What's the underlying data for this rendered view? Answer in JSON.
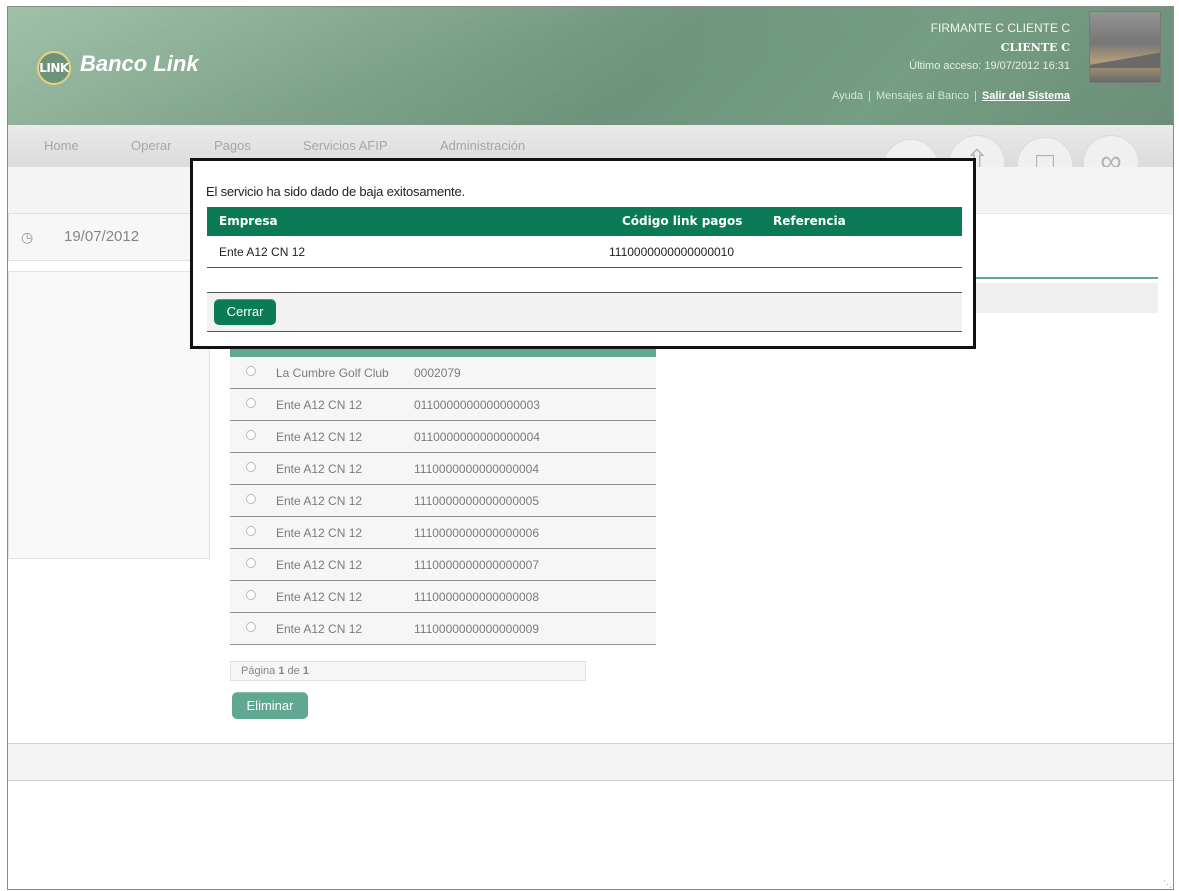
{
  "header": {
    "brand": "Banco Link",
    "logo_text": "LINK",
    "user_name": "FIRMANTE C CLIENTE C",
    "client_name": "CLIENTE C",
    "last_access": "Último acceso: 19/07/2012 16:31",
    "links": {
      "help": "Ayuda",
      "sep1": "|",
      "messages": "Mensajes al Banco",
      "sep2": "|",
      "logout": "Salir del Sistema"
    }
  },
  "nav": {
    "items": [
      "Home",
      "Operar",
      "Pagos",
      "Servicios AFIP",
      "Administración"
    ],
    "icons": [
      "user-icon",
      "upload-icon",
      "folder-icon",
      "attachments-icon"
    ]
  },
  "page": {
    "date": "19/07/2012",
    "services": [
      {
        "name": "La Cumbre Golf Club",
        "code": "0002079"
      },
      {
        "name": "Ente A12 CN 12",
        "code": "0110000000000000003"
      },
      {
        "name": "Ente A12 CN 12",
        "code": "0110000000000000004"
      },
      {
        "name": "Ente A12 CN 12",
        "code": "1110000000000000004"
      },
      {
        "name": "Ente A12 CN 12",
        "code": "1110000000000000005"
      },
      {
        "name": "Ente A12 CN 12",
        "code": "1110000000000000006"
      },
      {
        "name": "Ente A12 CN 12",
        "code": "1110000000000000007"
      },
      {
        "name": "Ente A12 CN 12",
        "code": "1110000000000000008"
      },
      {
        "name": "Ente A12 CN 12",
        "code": "1110000000000000009"
      }
    ],
    "pager": {
      "prefix": "Página",
      "current": "1",
      "of": "de",
      "total": "1"
    },
    "delete_label": "Eliminar"
  },
  "modal": {
    "message": "El servicio ha sido dado de baja exitosamente.",
    "columns": {
      "company": "Empresa",
      "code": "Código link pagos",
      "reference": "Referencia"
    },
    "row": {
      "company": "Ente A12 CN 12",
      "code": "1110000000000000010",
      "reference": ""
    },
    "close_label": "Cerrar"
  },
  "colors": {
    "primary_green": "#0b7a57",
    "header_green": "#1f5a36",
    "logo_ring": "#e0b830"
  }
}
